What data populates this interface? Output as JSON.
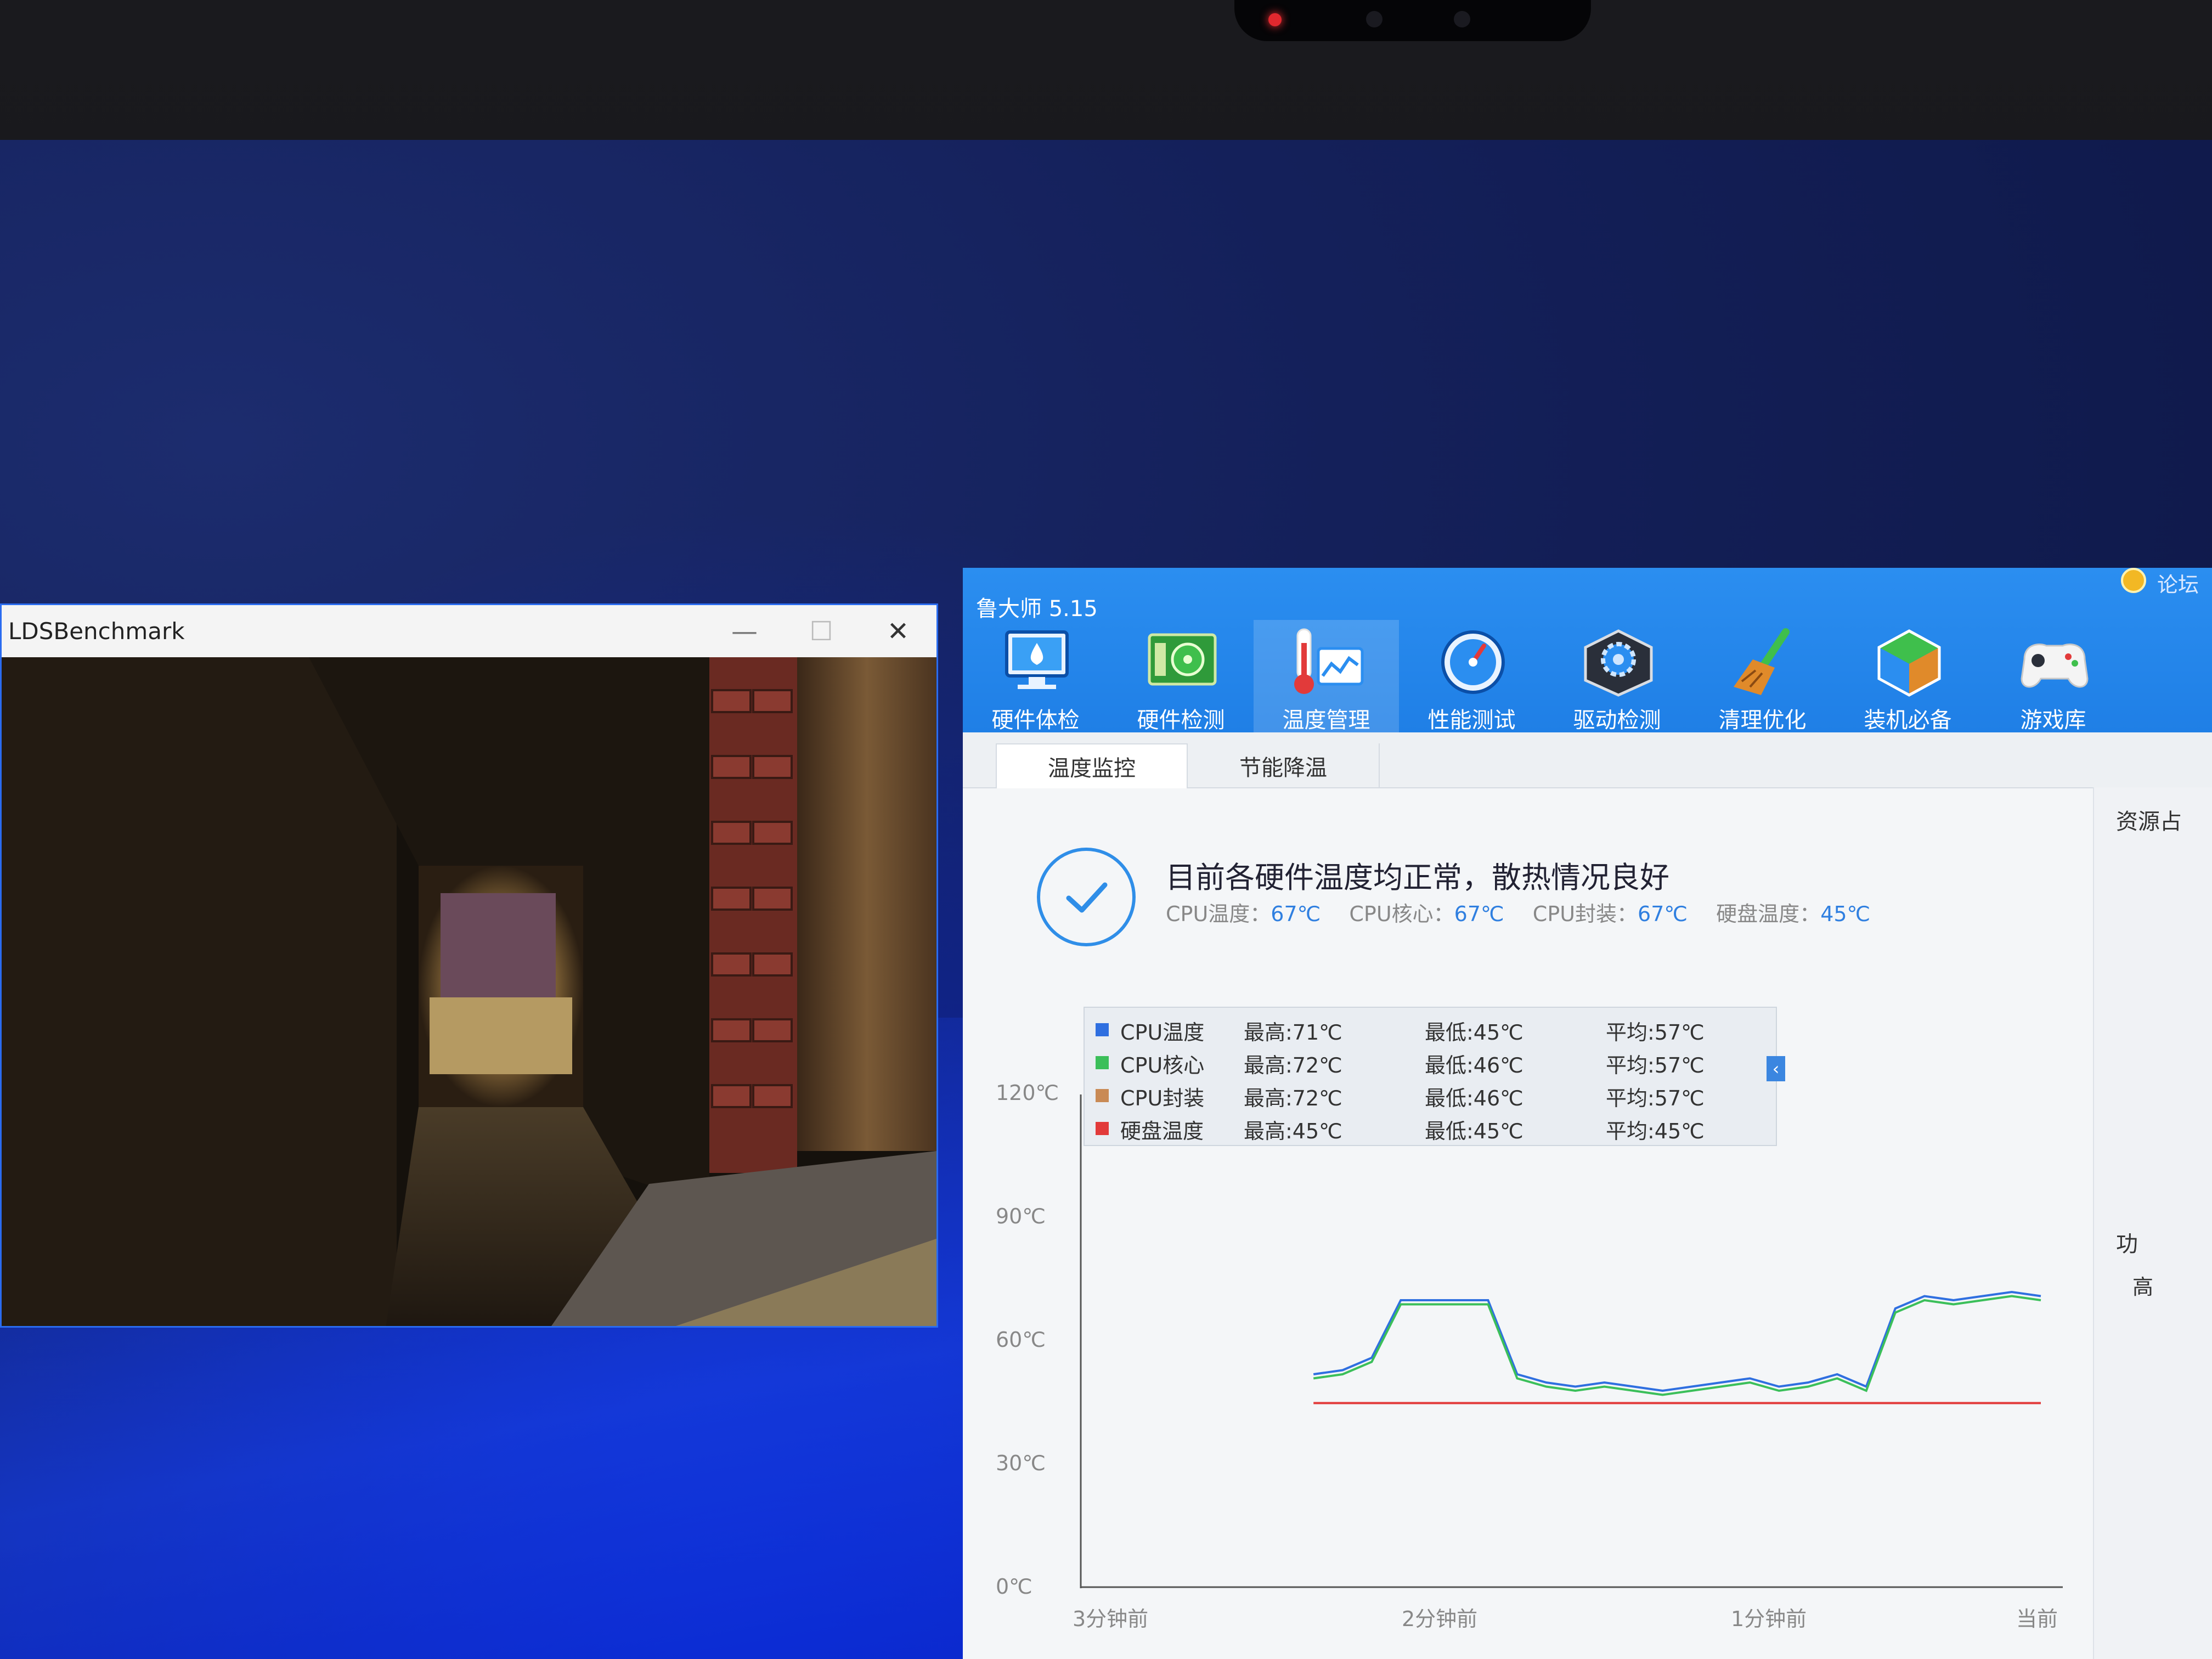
{
  "benchmark_window": {
    "title": "LDSBenchmark",
    "minimize": "—",
    "maximize": "☐",
    "close": "✕"
  },
  "app": {
    "title": "鲁大师 5.15",
    "forum": "论坛",
    "nav": [
      {
        "label": "硬件体检",
        "icon": "monitor-check-icon"
      },
      {
        "label": "硬件检测",
        "icon": "circuit-board-icon"
      },
      {
        "label": "温度管理",
        "icon": "thermometer-chart-icon",
        "active": true
      },
      {
        "label": "性能测试",
        "icon": "speedometer-icon"
      },
      {
        "label": "驱动检测",
        "icon": "gear-chip-icon"
      },
      {
        "label": "清理优化",
        "icon": "broom-icon"
      },
      {
        "label": "装机必备",
        "icon": "cube-box-icon"
      },
      {
        "label": "游戏库",
        "icon": "gamepad-icon"
      }
    ],
    "tabs": [
      {
        "label": "温度监控",
        "active": true
      },
      {
        "label": "节能降温",
        "active": false
      }
    ],
    "side_panel": {
      "title": "资源占",
      "section": "功",
      "item": "高"
    },
    "status": {
      "headline": "目前各硬件温度均正常，散热情况良好",
      "readings": [
        {
          "label": "CPU温度：",
          "value": "67℃"
        },
        {
          "label": "CPU核心：",
          "value": "67℃"
        },
        {
          "label": "CPU封装：",
          "value": "67℃"
        },
        {
          "label": "硬盘温度：",
          "value": "45℃"
        }
      ]
    },
    "legend": [
      {
        "name": "CPU温度",
        "max": "最高:71℃",
        "min": "最低:45℃",
        "avg": "平均:57℃",
        "color": "#2f6fe0"
      },
      {
        "name": "CPU核心",
        "max": "最高:72℃",
        "min": "最低:46℃",
        "avg": "平均:57℃",
        "color": "#3bbf5a"
      },
      {
        "name": "CPU封装",
        "max": "最高:72℃",
        "min": "最低:46℃",
        "avg": "平均:57℃",
        "color": "#c98a55"
      },
      {
        "name": "硬盘温度",
        "max": "最高:45℃",
        "min": "最低:45℃",
        "avg": "平均:45℃",
        "color": "#e23a3a"
      }
    ],
    "legend_toggle": "‹"
  },
  "chart_data": {
    "type": "line",
    "y_ticks": [
      "120℃",
      "90℃",
      "60℃",
      "30℃",
      "0℃"
    ],
    "x_ticks": [
      "3分钟前",
      "2分钟前",
      "1分钟前",
      "当前"
    ],
    "ylim": [
      0,
      120
    ],
    "x": [
      0,
      18,
      36,
      54,
      72,
      90,
      108,
      126,
      144,
      162,
      180
    ],
    "series": [
      {
        "name": "CPU温度",
        "color": "#2f6fe0",
        "values": [
          null,
          null,
          null,
          null,
          null,
          null,
          null,
          null,
          52,
          53,
          56,
          70,
          70,
          70,
          70,
          52,
          50,
          49,
          50,
          49,
          48,
          49,
          50,
          51,
          49,
          50,
          52,
          49,
          68,
          71,
          70,
          71,
          72,
          71
        ]
      },
      {
        "name": "CPU核心",
        "color": "#3bbf5a",
        "values": [
          null,
          null,
          null,
          null,
          null,
          null,
          null,
          null,
          51,
          52,
          55,
          69,
          69,
          69,
          69,
          51,
          49,
          48,
          49,
          48,
          47,
          48,
          49,
          50,
          48,
          49,
          51,
          48,
          67,
          70,
          69,
          70,
          71,
          70
        ]
      },
      {
        "name": "硬盘温度",
        "color": "#e23a3a",
        "values": [
          null,
          null,
          null,
          null,
          null,
          null,
          null,
          null,
          45,
          45,
          45,
          45,
          45,
          45,
          45,
          45,
          45,
          45,
          45,
          45,
          45,
          45,
          45,
          45,
          45,
          45,
          45,
          45,
          45,
          45,
          45,
          45,
          45,
          45
        ]
      }
    ]
  }
}
